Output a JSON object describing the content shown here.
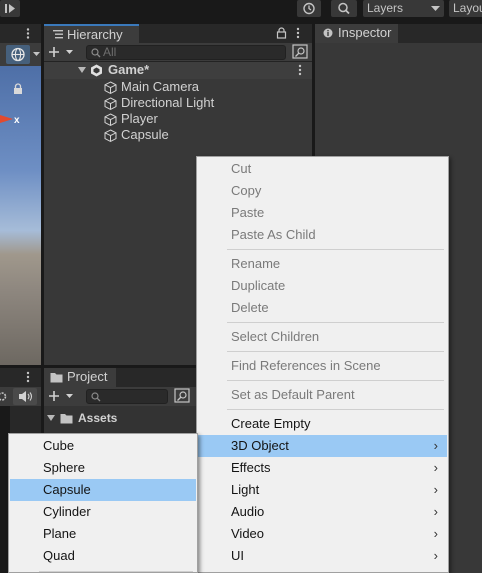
{
  "toolbar": {
    "layers_label": "Layers",
    "layout_label": "Layout"
  },
  "hierarchy": {
    "tab_label": "Hierarchy",
    "search_placeholder": "All",
    "scene_name": "Game*",
    "items": [
      {
        "label": "Main Camera"
      },
      {
        "label": "Directional Light"
      },
      {
        "label": "Player"
      },
      {
        "label": "Capsule"
      }
    ]
  },
  "inspector": {
    "tab_label": "Inspector"
  },
  "project": {
    "tab_label": "Project",
    "root_folder": "Assets"
  },
  "context_menu": {
    "groups": [
      [
        "Cut",
        "Copy",
        "Paste",
        "Paste As Child"
      ],
      [
        "Rename",
        "Duplicate",
        "Delete"
      ],
      [
        "Select Children"
      ],
      [
        "Find References in Scene"
      ],
      [
        "Set as Default Parent"
      ]
    ],
    "items": [
      {
        "label": "Create Empty"
      },
      {
        "label": "3D Object",
        "submenu": true,
        "highlighted": true
      },
      {
        "label": "Effects",
        "submenu": true
      },
      {
        "label": "Light",
        "submenu": true
      },
      {
        "label": "Audio",
        "submenu": true
      },
      {
        "label": "Video",
        "submenu": true
      },
      {
        "label": "UI",
        "submenu": true
      }
    ]
  },
  "submenu": {
    "items": [
      {
        "label": "Cube"
      },
      {
        "label": "Sphere"
      },
      {
        "label": "Capsule",
        "highlighted": true
      },
      {
        "label": "Cylinder"
      },
      {
        "label": "Plane"
      },
      {
        "label": "Quad"
      }
    ]
  },
  "colors": {
    "highlight": "#9ac9f4",
    "tab_accent": "#3a79bb",
    "panel_bg": "#383838"
  }
}
